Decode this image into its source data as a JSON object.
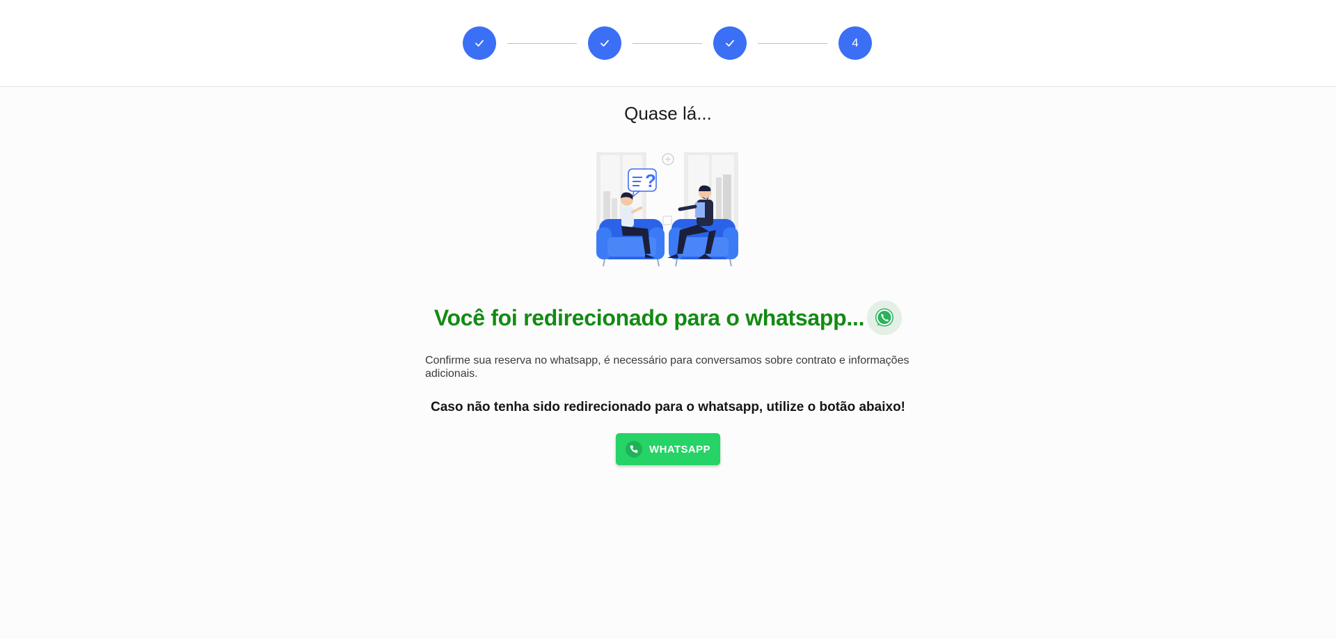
{
  "stepper": {
    "steps": [
      {
        "state": "done",
        "icon": "check-icon"
      },
      {
        "state": "done",
        "icon": "check-icon"
      },
      {
        "state": "done",
        "icon": "check-icon"
      },
      {
        "state": "current",
        "label": "4"
      }
    ],
    "accent_color": "#3b6ff5"
  },
  "page": {
    "subtitle": "Quase lá...",
    "illustration": "two-people-conversation-illustration",
    "headline": "Você foi redirecionado para o whatsapp...",
    "headline_icon": "whatsapp-icon",
    "headline_color": "#138a13",
    "description": "Confirme sua reserva no whatsapp, é necessário para conversamos sobre contrato e informações adicionais.",
    "notice": "Caso não tenha sido redirecionado para o whatsapp, utilize o botão abaixo!",
    "button": {
      "label": "WHATSAPP",
      "icon": "phone-icon",
      "color": "#25d366"
    }
  }
}
